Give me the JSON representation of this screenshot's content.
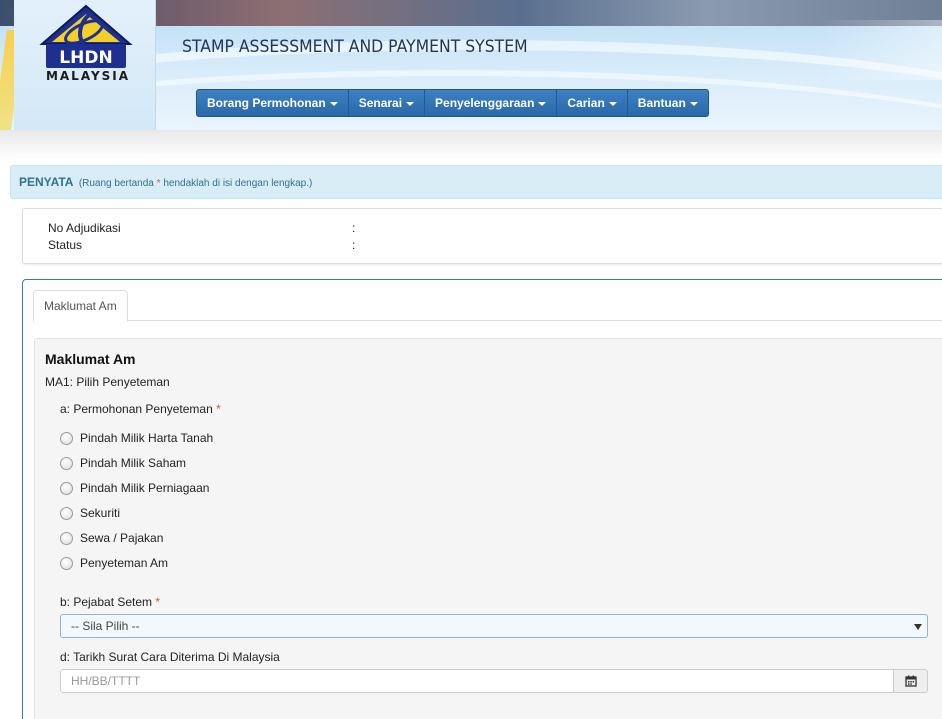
{
  "branding": {
    "logo_text": "LHDN",
    "logo_subtext": "MALAYSIA",
    "app_title": "STAMP ASSESSMENT AND PAYMENT SYSTEM"
  },
  "nav": {
    "items": [
      {
        "label": "Borang Permohonan"
      },
      {
        "label": "Senarai"
      },
      {
        "label": "Penyelenggaraan"
      },
      {
        "label": "Carian"
      },
      {
        "label": "Bantuan"
      }
    ]
  },
  "penyata": {
    "title": "PENYATA",
    "note_prefix": "(Ruang bertanda ",
    "note_star": "*",
    "note_suffix": " hendaklah di isi dengan lengkap.)"
  },
  "info": {
    "adjudikasi_label": "No Adjudikasi",
    "adjudikasi_value": "",
    "status_label": "Status",
    "status_value": "",
    "colon": ":"
  },
  "tabs": [
    {
      "label": "Maklumat Am",
      "active": true
    }
  ],
  "form": {
    "section_title": "Maklumat Am",
    "section_sub": "MA1: Pilih Penyeteman",
    "q_a_label": "a: Permohonan Penyeteman",
    "required_star": "*",
    "options": [
      "Pindah Milik Harta Tanah",
      "Pindah Milik Saham",
      "Pindah Milik Perniagaan",
      "Sekuriti",
      "Sewa / Pajakan",
      "Penyeteman Am"
    ],
    "q_b_label": "b: Pejabat Setem",
    "q_b_selected": "-- Sila Pilih --",
    "q_d_label": "d: Tarikh Surat Cara Diterima Di Malaysia",
    "q_d_placeholder": "HH/BB/TTTT"
  },
  "colors": {
    "nav_bg": "#2a68a8",
    "panel_border": "#337ab7",
    "penyata_bg": "#d9edf7",
    "required": "#d9534f"
  }
}
